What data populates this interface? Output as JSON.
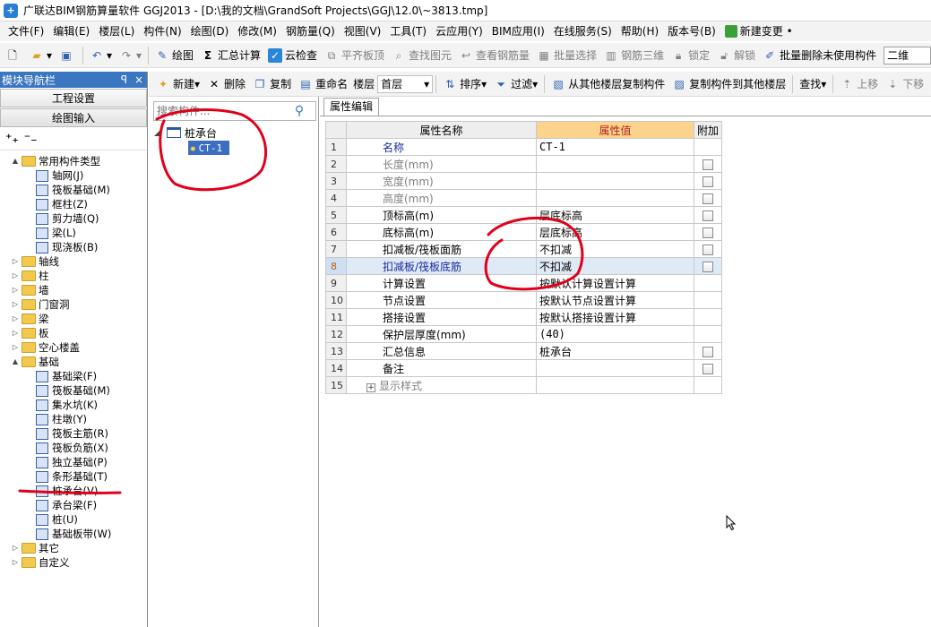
{
  "window": {
    "title": "广联达BIM钢筋算量软件 GGJ2013 - [D:\\我的文档\\GrandSoft Projects\\GGJ\\12.0\\~3813.tmp]"
  },
  "menu": [
    "文件(F)",
    "编辑(E)",
    "楼层(L)",
    "构件(N)",
    "绘图(D)",
    "修改(M)",
    "钢筋量(Q)",
    "视图(V)",
    "工具(T)",
    "云应用(Y)",
    "BIM应用(I)",
    "在线服务(S)",
    "帮助(H)",
    "版本号(B)",
    "新建变更 •"
  ],
  "toolbar1": {
    "draw": "绘图",
    "sum": "汇总计算",
    "cloud_check": "云检查",
    "flat_top": "平齐板顶",
    "find_elem": "查找图元",
    "view_rebar": "查看钢筋量",
    "batch_select": "批量选择",
    "rebar_3d": "钢筋三维",
    "lock": "锁定",
    "unlock": "解锁",
    "batch_delete": "批量删除未使用构件",
    "view_mode": "二维"
  },
  "nav": {
    "header": "模块导航栏",
    "header_controls": [
      "ꟼ",
      "×"
    ],
    "project_settings": "工程设置",
    "drawing_input": "绘图输入",
    "tree": [
      {
        "level": 0,
        "exp": "▲",
        "type": "folder",
        "label": "常用构件类型"
      },
      {
        "level": 1,
        "label": "轴网(J)"
      },
      {
        "level": 1,
        "label": "筏板基础(M)"
      },
      {
        "level": 1,
        "label": "框柱(Z)"
      },
      {
        "level": 1,
        "label": "剪力墙(Q)"
      },
      {
        "level": 1,
        "label": "梁(L)"
      },
      {
        "level": 1,
        "label": "现浇板(B)"
      },
      {
        "level": 0,
        "exp": "▷",
        "type": "folder",
        "label": "轴线"
      },
      {
        "level": 0,
        "exp": "▷",
        "type": "folder",
        "label": "柱"
      },
      {
        "level": 0,
        "exp": "▷",
        "type": "folder",
        "label": "墙"
      },
      {
        "level": 0,
        "exp": "▷",
        "type": "folder",
        "label": "门窗洞"
      },
      {
        "level": 0,
        "exp": "▷",
        "type": "folder",
        "label": "梁"
      },
      {
        "level": 0,
        "exp": "▷",
        "type": "folder",
        "label": "板"
      },
      {
        "level": 0,
        "exp": "▷",
        "type": "folder",
        "label": "空心楼盖"
      },
      {
        "level": 0,
        "exp": "▲",
        "type": "folder",
        "label": "基础"
      },
      {
        "level": 1,
        "label": "基础梁(F)"
      },
      {
        "level": 1,
        "label": "筏板基础(M)"
      },
      {
        "level": 1,
        "label": "集水坑(K)"
      },
      {
        "level": 1,
        "label": "柱墩(Y)"
      },
      {
        "level": 1,
        "label": "筏板主筋(R)"
      },
      {
        "level": 1,
        "label": "筏板负筋(X)"
      },
      {
        "level": 1,
        "label": "独立基础(P)"
      },
      {
        "level": 1,
        "label": "条形基础(T)"
      },
      {
        "level": 1,
        "label": "桩承台(V)"
      },
      {
        "level": 1,
        "label": "承台梁(F)"
      },
      {
        "level": 1,
        "label": "桩(U)"
      },
      {
        "level": 1,
        "label": "基础板带(W)"
      },
      {
        "level": 0,
        "exp": "▷",
        "type": "folder",
        "label": "其它"
      },
      {
        "level": 0,
        "exp": "▷",
        "type": "folder",
        "label": "自定义"
      }
    ]
  },
  "toolbar2": {
    "new": "新建",
    "delete": "删除",
    "copy": "复制",
    "rename": "重命名",
    "floor_label": "楼层",
    "floor_value": "首层",
    "sort": "排序",
    "filter": "过滤",
    "copy_from": "从其他楼层复制构件",
    "copy_to": "复制构件到其他楼层",
    "find": "查找",
    "up": "上移",
    "down": "下移"
  },
  "components": {
    "search_placeholder": "搜索构件...",
    "root": "桩承台",
    "selected": "CT-1"
  },
  "props": {
    "tab": "属性编辑",
    "col_name": "属性名称",
    "col_value": "属性值",
    "col_extra": "附加",
    "rows": [
      {
        "n": "1",
        "name": "名称",
        "value": "CT-1",
        "cb": false,
        "style": "blue",
        "mono": true
      },
      {
        "n": "2",
        "name": "长度(mm)",
        "value": "",
        "cb": true,
        "style": "grey"
      },
      {
        "n": "3",
        "name": "宽度(mm)",
        "value": "",
        "cb": true,
        "style": "grey"
      },
      {
        "n": "4",
        "name": "高度(mm)",
        "value": "",
        "cb": true,
        "style": "grey"
      },
      {
        "n": "5",
        "name": "顶标高(m)",
        "value": "层底标高",
        "cb": true,
        "style": ""
      },
      {
        "n": "6",
        "name": "底标高(m)",
        "value": "层底标高",
        "cb": true,
        "style": ""
      },
      {
        "n": "7",
        "name": "扣减板/筏板面筋",
        "value": "不扣减",
        "cb": true,
        "style": ""
      },
      {
        "n": "8",
        "name": "扣减板/筏板底筋",
        "value": "不扣减",
        "cb": true,
        "style": "",
        "selected": true
      },
      {
        "n": "9",
        "name": "计算设置",
        "value": "按默认计算设置计算",
        "cb": false,
        "style": ""
      },
      {
        "n": "10",
        "name": "节点设置",
        "value": "按默认节点设置计算",
        "cb": false,
        "style": ""
      },
      {
        "n": "11",
        "name": "搭接设置",
        "value": "按默认搭接设置计算",
        "cb": false,
        "style": ""
      },
      {
        "n": "12",
        "name": "保护层厚度(mm)",
        "value": "(40)",
        "cb": false,
        "style": "",
        "mono": true
      },
      {
        "n": "13",
        "name": "汇总信息",
        "value": "桩承台",
        "cb": true,
        "style": ""
      },
      {
        "n": "14",
        "name": "备注",
        "value": "",
        "cb": true,
        "style": ""
      },
      {
        "n": "15",
        "name": "显示样式",
        "value": "",
        "cb": false,
        "style": "grey",
        "plus": true
      }
    ]
  },
  "colors": {
    "nav_header": "#3b76c0",
    "selection": "#3c6fbf",
    "value_header": "#fbd38d",
    "annotation": "#e0001b"
  }
}
